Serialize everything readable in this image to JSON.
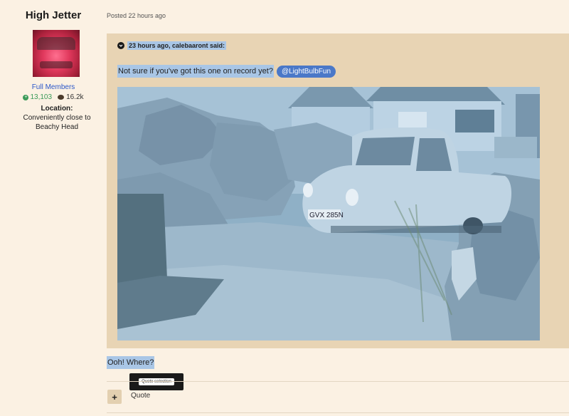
{
  "author": {
    "name": "High Jetter",
    "avatar_icon": "avatar-photo",
    "group": "Full Members",
    "reputation": "13,103",
    "posts": "16.2k",
    "location_label": "Location:",
    "location_value": "Conveniently close to Beachy Head"
  },
  "post": {
    "posted": "Posted 22 hours ago",
    "quote": {
      "header": "23 hours ago, calebaaront said:",
      "text": "Not sure if you've got this one on record yet?",
      "mention": "@LightBulbFun",
      "image_icon": "photo-three-wheeler-car",
      "plate": "GVX 285N"
    },
    "reply": "Ooh! Where?",
    "quote_selection_label": "Quote selection",
    "plus_label": "+",
    "quote_label": "Quote"
  },
  "colors": {
    "background": "#fbf1e3",
    "quote_bg": "#e8d4b4",
    "selection": "#a9c6e6",
    "mention": "#4a78c8",
    "link": "#2b57c9",
    "reputation": "#3b9a58"
  }
}
